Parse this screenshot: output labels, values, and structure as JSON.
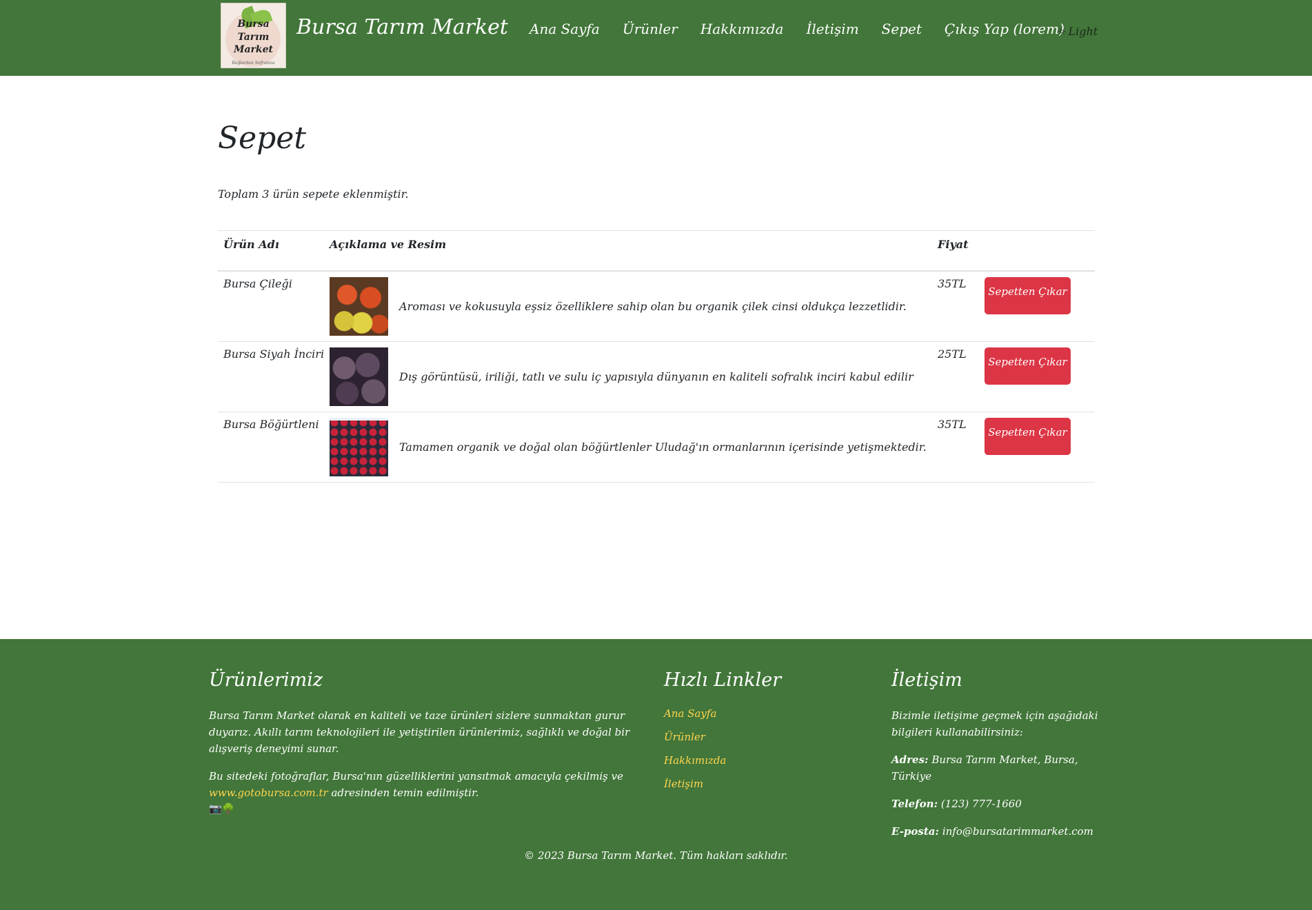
{
  "header": {
    "logo_line1": "Bursa Tarım",
    "logo_line2": "Market",
    "logo_sub": "Bağlardan Sofranıza",
    "brand": "Bursa Tarım Market",
    "nav": [
      "Ana Sayfa",
      "Ürünler",
      "Hakkımızda",
      "İletişim",
      "Sepet",
      "Çıkış Yap (lorem)"
    ],
    "theme_icon": "sun-icon",
    "theme_label": "Light"
  },
  "main": {
    "title": "Sepet",
    "summary": "Toplam 3 ürün sepete eklenmiştir.",
    "table": {
      "headers": [
        "Ürün Adı",
        "Açıklama ve Resim",
        "Fiyat",
        ""
      ],
      "rows": [
        {
          "name": "Bursa Çileği",
          "desc": "Aroması ve kokusuyla eşsiz özelliklere sahip olan bu organik çilek cinsi oldukça lezzetlidir.",
          "price": "35TL",
          "action": "Sepetten Çıkar"
        },
        {
          "name": "Bursa Siyah İnciri",
          "desc": "Dış görüntüsü, iriliği, tatlı ve sulu iç yapısıyla dünyanın en kaliteli sofralık inciri kabul edilir",
          "price": "25TL",
          "action": "Sepetten Çıkar"
        },
        {
          "name": "Bursa Böğürtleni",
          "desc": "Tamamen organik ve doğal olan böğürtlenler Uludağ'ın ormanlarının içerisinde yetişmektedir.",
          "price": "35TL",
          "action": "Sepetten Çıkar"
        }
      ]
    }
  },
  "footer": {
    "products": {
      "title": "Ürünlerimiz",
      "text1": "Bursa Tarım Market olarak en kaliteli ve taze ürünleri sizlere sunmaktan gurur duyarız. Akıllı tarım teknolojileri ile yetiştirilen ürünlerimiz, sağlıklı ve doğal bir alışveriş deneyimi sunar.",
      "text2_pre": "Bu sitedeki fotoğraflar, Bursa'nın güzelliklerini yansıtmak amacıyla çekilmiş ve",
      "text2_link": "www.gotobursa.com.tr",
      "text2_post": " adresinden temin edilmiştir.",
      "icons": "📷🌳"
    },
    "quick_links": {
      "title": "Hızlı Linkler",
      "items": [
        "Ana Sayfa",
        "Ürünler",
        "Hakkımızda",
        "İletişim"
      ]
    },
    "contact": {
      "title": "İletişim",
      "intro": "Bizimle iletişime geçmek için aşağıdaki bilgileri kullanabilirsiniz:",
      "address_label": "Adres:",
      "address": " Bursa Tarım Market, Bursa, Türkiye",
      "phone_label": "Telefon:",
      "phone": " (123) 777-1660",
      "email_label": "E-posta:",
      "email": " info@bursatarimmarket.com"
    },
    "copyright": "© 2023 Bursa Tarım Market. Tüm hakları saklıdır."
  }
}
